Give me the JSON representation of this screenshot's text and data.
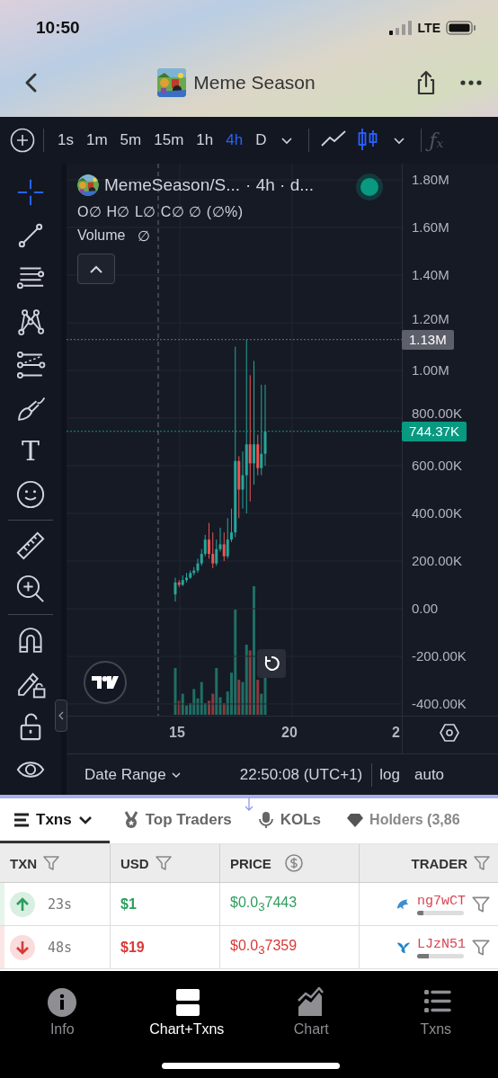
{
  "status_bar": {
    "time": "10:50",
    "network": "LTE"
  },
  "header": {
    "title": "Meme Season"
  },
  "toolbar": {
    "intervals": [
      {
        "label": "1s",
        "selected": false
      },
      {
        "label": "1m",
        "selected": false
      },
      {
        "label": "5m",
        "selected": false
      },
      {
        "label": "15m",
        "selected": false
      },
      {
        "label": "1h",
        "selected": false
      },
      {
        "label": "4h",
        "selected": true
      },
      {
        "label": "D",
        "selected": false
      }
    ],
    "chart_styles": [
      {
        "kind": "line",
        "selected": false
      },
      {
        "kind": "candles",
        "selected": true
      }
    ],
    "indicator": {
      "label": "ƒₓ",
      "disabled": true
    }
  },
  "tool_groups": [
    [
      {
        "kind": "crosshair",
        "selected": true
      },
      {
        "kind": "trend-line",
        "selected": false
      },
      {
        "kind": "parallel-lines",
        "selected": false
      },
      {
        "kind": "pattern",
        "selected": false
      },
      {
        "kind": "fib-lines",
        "selected": false
      },
      {
        "kind": "brush",
        "selected": false
      },
      {
        "kind": "text",
        "label": "T",
        "selected": false
      },
      {
        "kind": "emoji",
        "selected": false
      }
    ],
    [
      {
        "kind": "ruler",
        "selected": false
      },
      {
        "kind": "zoom",
        "selected": false
      }
    ],
    [
      {
        "kind": "magnet",
        "selected": false
      },
      {
        "kind": "lock-drawing",
        "selected": false
      },
      {
        "kind": "lock",
        "selected": false
      },
      {
        "kind": "eye",
        "selected": false
      }
    ]
  ],
  "chart": {
    "symbol": "MemeSeason/S...",
    "timeframe": "· 4h · d...",
    "live": true,
    "ohlc": "O∅ H∅ L∅ C∅ ∅ (∅%)",
    "volume_label": "Volume",
    "volume_value": "∅",
    "cut_tick_label": "2",
    "chart_data": {
      "type": "candlestick",
      "grid": true,
      "xlim": [
        9.96,
        29.16
      ],
      "ylim": [
        -449057,
        1867925
      ],
      "ref_lines": [
        {
          "axis": "x",
          "color": "#5d606b",
          "value": 14.04
        },
        {
          "axis": "y",
          "color": "#5d606b",
          "value": 1130000,
          "label": "1.13M"
        },
        {
          "axis": "y",
          "color": "#089981",
          "value": 744370,
          "label": "744.37K"
        }
      ],
      "x": [
        14.8,
        14.97,
        15.13,
        15.3,
        15.47,
        15.63,
        15.8,
        15.97,
        16.13,
        16.3,
        16.47,
        16.63,
        16.8,
        16.97,
        17.13,
        17.3,
        17.47,
        17.63,
        17.8,
        17.97,
        18.13,
        18.3,
        18.47,
        18.63,
        18.8
      ],
      "ohlc": [
        [
          60000,
          130000,
          30000,
          110000
        ],
        [
          110000,
          120000,
          90000,
          100000
        ],
        [
          100000,
          140000,
          95000,
          120000
        ],
        [
          120000,
          150000,
          110000,
          130000
        ],
        [
          130000,
          160000,
          125000,
          150000
        ],
        [
          150000,
          175000,
          140000,
          160000
        ],
        [
          160000,
          210000,
          150000,
          190000
        ],
        [
          190000,
          250000,
          180000,
          230000
        ],
        [
          230000,
          310000,
          220000,
          290000
        ],
        [
          290000,
          360000,
          210000,
          230000
        ],
        [
          230000,
          320000,
          170000,
          190000
        ],
        [
          190000,
          290000,
          180000,
          250000
        ],
        [
          250000,
          340000,
          240000,
          270000
        ],
        [
          270000,
          320000,
          200000,
          220000
        ],
        [
          220000,
          380000,
          210000,
          290000
        ],
        [
          290000,
          420000,
          280000,
          320000
        ],
        [
          320000,
          1100000,
          300000,
          620000
        ],
        [
          620000,
          640000,
          380000,
          500000
        ],
        [
          500000,
          660000,
          420000,
          560000
        ],
        [
          560000,
          1130000,
          400000,
          690000
        ],
        [
          690000,
          980000,
          450000,
          610000
        ],
        [
          610000,
          1040000,
          520000,
          690000
        ],
        [
          690000,
          730000,
          560000,
          590000
        ],
        [
          590000,
          940000,
          560000,
          650000
        ],
        [
          650000,
          940000,
          600000,
          744370
        ]
      ],
      "yticks": [
        {
          "value": 1800000,
          "label": "1.80M"
        },
        {
          "value": 1600000,
          "label": "1.60M"
        },
        {
          "value": 1400000,
          "label": "1.40M"
        },
        {
          "value": 1200000,
          "label": "1.20M"
        },
        {
          "value": 1000000,
          "label": "1.00M"
        },
        {
          "value": 800000,
          "label": "800.00K"
        },
        {
          "value": 600000,
          "label": "600.00K"
        },
        {
          "value": 400000,
          "label": "400.00K"
        },
        {
          "value": 200000,
          "label": "200.00K"
        },
        {
          "value": 0,
          "label": "0.00"
        },
        {
          "value": -200000,
          "label": "-200.00K"
        },
        {
          "value": -400000,
          "label": "-400.00K"
        }
      ],
      "xticks": [
        {
          "value": 15,
          "label": "15"
        },
        {
          "value": 20,
          "label": "20"
        }
      ]
    },
    "date_range": "Date Range",
    "clock": "22:50:08 (UTC+1)",
    "scale_options": [
      "log",
      "auto"
    ]
  },
  "tabs": [
    {
      "label": "Txns",
      "kind": "menu",
      "selected": true
    },
    {
      "label": "Top Traders",
      "kind": "medal",
      "selected": false
    },
    {
      "label": "KOLs",
      "kind": "mic",
      "selected": false
    },
    {
      "label": "Holders (3,86",
      "kind": "gem",
      "selected": false
    }
  ],
  "table": {
    "columns": [
      {
        "label": "TXN",
        "kind": "filter"
      },
      {
        "label": "USD",
        "kind": "filter"
      },
      {
        "label": "PRICE",
        "kind": "currency"
      },
      {
        "label": "TRADER",
        "kind": "filter"
      }
    ],
    "rows": [
      {
        "kind": "buy",
        "age": "23s",
        "usd": "$1",
        "price": "$0.0$_{3}$7443",
        "trader": {
          "kind": "dolphin",
          "name": "ng7wCT",
          "level": 0.14
        }
      },
      {
        "kind": "sell",
        "age": "48s",
        "usd": "$19",
        "price": "$0.0$_{3}$7359",
        "trader": {
          "kind": "whale",
          "name": "LJzN51",
          "level": 0.25
        }
      }
    ]
  },
  "bottom_nav": [
    {
      "label": "Info",
      "kind": "info",
      "selected": false
    },
    {
      "label": "Chart+Txns",
      "kind": "split",
      "selected": true
    },
    {
      "label": "Chart",
      "kind": "area",
      "selected": false
    },
    {
      "label": "Txns",
      "kind": "list",
      "selected": false
    }
  ]
}
